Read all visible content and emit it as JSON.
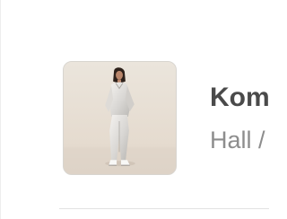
{
  "product": {
    "image": "model-wearing-light-grey-loungewear-set",
    "title": "Kom",
    "subtitle": "Hall /"
  },
  "colors": {
    "background": "#ffffff",
    "image_background": "#e9e2d8",
    "title": "#4a4a4a",
    "subtitle": "#8d8d8d",
    "divider": "#e2e2e2"
  }
}
